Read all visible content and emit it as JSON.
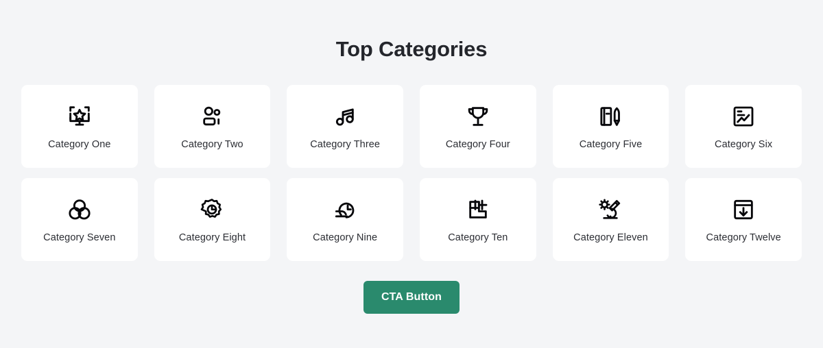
{
  "theme": {
    "page_background": "#f4f5f7",
    "card_background": "#ffffff",
    "text_color": "#2b2d33",
    "title_color": "#24262c",
    "accent_color": "#2a8a6d",
    "icon_color": "#07070a",
    "cta_text_color": "#ffffff"
  },
  "header": {
    "title": "Top Categories"
  },
  "grid": {
    "columns": 6,
    "rows": 2,
    "cards": [
      {
        "label": "Category One",
        "icon": "monitor-star-icon"
      },
      {
        "label": "Category Two",
        "icon": "users-group-icon"
      },
      {
        "label": "Category Three",
        "icon": "music-note-icon"
      },
      {
        "label": "Category Four",
        "icon": "trophy-icon"
      },
      {
        "label": "Category Five",
        "icon": "notebook-pencil-icon"
      },
      {
        "label": "Category Six",
        "icon": "line-chart-icon"
      },
      {
        "label": "Category Seven",
        "icon": "venn-diagram-icon"
      },
      {
        "label": "Category Eight",
        "icon": "gear-pie-chart-icon"
      },
      {
        "label": "Category Nine",
        "icon": "fast-clock-icon"
      },
      {
        "label": "Category Ten",
        "icon": "layout-blocks-icon"
      },
      {
        "label": "Category Eleven",
        "icon": "microscope-germ-icon"
      },
      {
        "label": "Category Twelve",
        "icon": "download-box-icon"
      }
    ]
  },
  "cta": {
    "label": "CTA Button"
  }
}
